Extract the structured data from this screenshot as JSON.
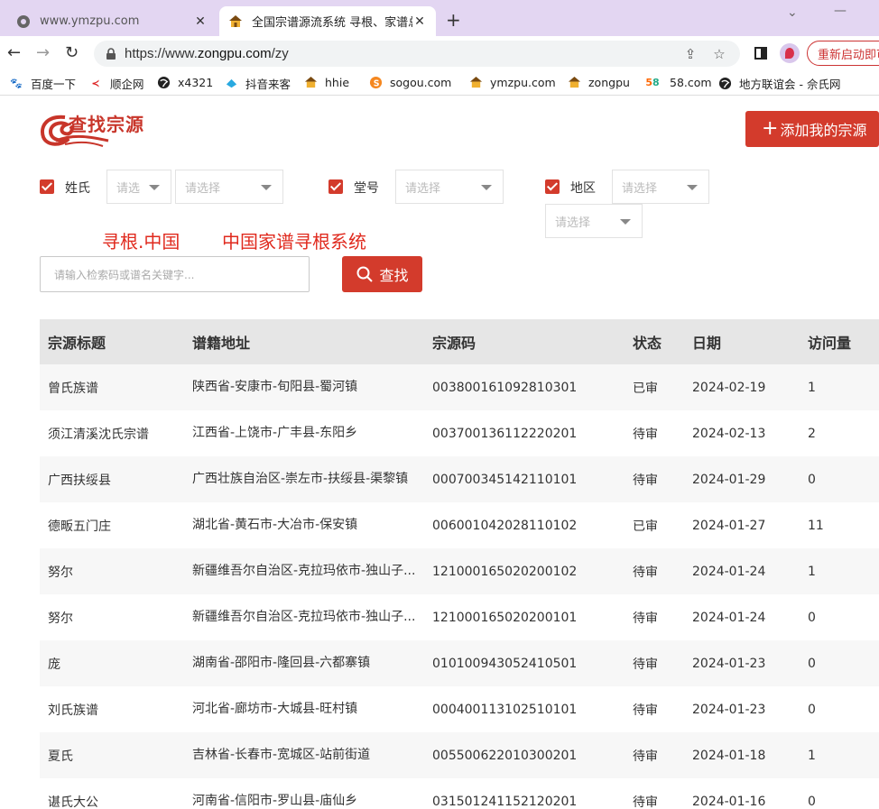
{
  "browser": {
    "tabs": [
      {
        "title": "www.ymzpu.com",
        "active": false
      },
      {
        "title": "全国宗谱源流系统 寻根、家谱总汇",
        "active": true
      }
    ],
    "url_prefix": "https://www.",
    "url_host": "zongpu.com",
    "url_path": "/zy",
    "restart_label": "重新启动即可",
    "bookmarks": [
      {
        "label": "百度一下",
        "icon": "baidu-icon"
      },
      {
        "label": "顺企网",
        "icon": "shunqi-icon"
      },
      {
        "label": "x4321",
        "icon": "globe-icon"
      },
      {
        "label": "抖音来客",
        "icon": "douyin-icon"
      },
      {
        "label": "hhie",
        "icon": "temple-icon"
      },
      {
        "label": "sogou.com",
        "icon": "sogou-icon"
      },
      {
        "label": "ymzpu.com",
        "icon": "temple-icon"
      },
      {
        "label": "zongpu",
        "icon": "temple-icon"
      },
      {
        "label": "58.com",
        "icon": "58-icon"
      },
      {
        "label": "地方联谊会 - 佘氏网",
        "icon": "globe-icon"
      }
    ]
  },
  "header": {
    "logo_text": "查找宗源",
    "add_button": "添加我的宗源"
  },
  "filters": {
    "surname_label": "姓氏",
    "hall_label": "堂号",
    "region_label": "地区",
    "select_placeholder": "请选择",
    "select_placeholder_short": "请选",
    "select_placeholder_trunc": "请选择"
  },
  "slogans": [
    "寻根.中国",
    "中国家谱寻根系统"
  ],
  "search": {
    "placeholder": "请输入检索码或谱名关键字...",
    "button": "查找"
  },
  "table": {
    "headers": [
      "宗源标题",
      "谱籍地址",
      "宗源码",
      "状态",
      "日期",
      "访问量"
    ],
    "rows": [
      [
        "曾氏族谱",
        "陕西省-安康市-旬阳县-蜀河镇",
        "003800161092810301",
        "已审",
        "2024-02-19",
        "1"
      ],
      [
        "须江清溪沈氏宗谱",
        "江西省-上饶市-广丰县-东阳乡",
        "003700136112220201",
        "待审",
        "2024-02-13",
        "2"
      ],
      [
        "广西扶绥县",
        "广西壮族自治区-崇左市-扶绥县-渠黎镇",
        "000700345142110101",
        "待审",
        "2024-01-29",
        "0"
      ],
      [
        "德畈五门庄",
        "湖北省-黄石市-大冶市-保安镇",
        "006001042028110102",
        "已审",
        "2024-01-27",
        "11"
      ],
      [
        "努尔",
        "新疆维吾尔自治区-克拉玛依市-独山子...",
        "121000165020200102",
        "待审",
        "2024-01-24",
        "1"
      ],
      [
        "努尔",
        "新疆维吾尔自治区-克拉玛依市-独山子...",
        "121000165020200101",
        "待审",
        "2024-01-24",
        "0"
      ],
      [
        "庞",
        "湖南省-邵阳市-隆回县-六都寨镇",
        "010100943052410501",
        "待审",
        "2024-01-23",
        "0"
      ],
      [
        "刘氏族谱",
        "河北省-廊坊市-大城县-旺村镇",
        "000400113102510101",
        "待审",
        "2024-01-23",
        "0"
      ],
      [
        "夏氏",
        "吉林省-长春市-宽城区-站前街道",
        "005500622010300201",
        "待审",
        "2024-01-18",
        "1"
      ],
      [
        "谌氏大公",
        "河南省-信阳市-罗山县-庙仙乡",
        "031501241152120201",
        "待审",
        "2024-01-16",
        "0"
      ]
    ]
  },
  "colors": {
    "accent": "#d33b2c",
    "slogan": "#e02a1e",
    "tabbar": "#e3d6f2"
  }
}
